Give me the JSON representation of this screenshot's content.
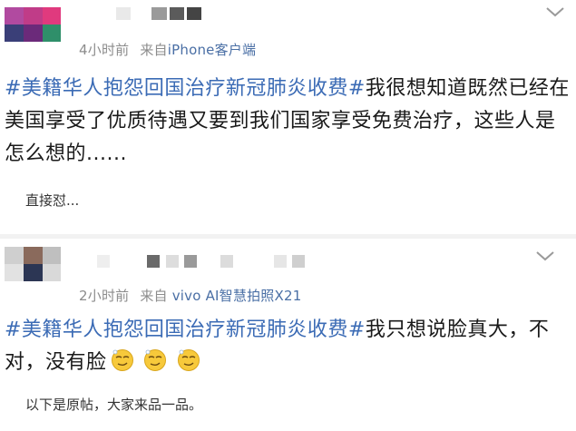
{
  "feed": {
    "posts": [
      {
        "meta": {
          "time": "4小时前",
          "source_label": "来自",
          "source_device": "iPhone客户端"
        },
        "hashtag": "#美籍华人抱怨回国治疗新冠肺炎收费#",
        "body": "我很想知道既然已经在美国享受了优质待遇又要到我们国家享受免费治疗，这些人是怎么想的......",
        "reply": "直接怼..."
      },
      {
        "meta": {
          "time": "2小时前",
          "source_label": "来自",
          "source_device": "vivo AI智慧拍照X21"
        },
        "hashtag": "#美籍华人抱怨回国治疗新冠肺炎收费#",
        "body": "我只想说脸真大，不对，没有脸",
        "emoji_icons": [
          "smirk-emoji-icon",
          "smirk-emoji-icon",
          "smirk-emoji-icon"
        ],
        "reply": "以下是原帖，大家来品一品。"
      }
    ]
  },
  "colors": {
    "hashtag": "#3b6bb5",
    "meta_gray": "#8c8c8c",
    "source_device_blue": "#4a6fa5",
    "divider": "#f2f2f2",
    "emoji_yellow": "#f7c93b"
  }
}
